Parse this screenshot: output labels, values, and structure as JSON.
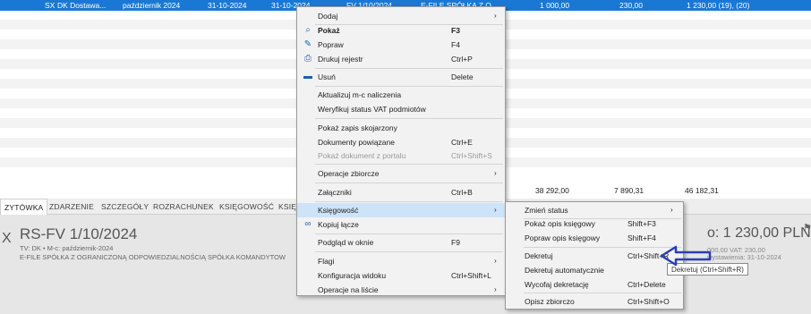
{
  "grid": {
    "selected_row": {
      "col1": "SX",
      "col2": "DK Dostawa...",
      "col3": "październik 2024",
      "col4": "31-10-2024",
      "col5": "31-10-2024",
      "col6": "FV 1/10/2024",
      "col7": "E-FILE SPÓŁKA Z O...",
      "col8": "1 000,00",
      "col9": "230,00",
      "col10": "1 230,00 (19), (20)"
    },
    "totals": {
      "net": "38 292,00",
      "vat": "7 890,31",
      "gross": "46 182,31"
    }
  },
  "tabs": [
    {
      "label": "ZYTÓWKA"
    },
    {
      "label": "ZDARZENIE"
    },
    {
      "label": "SZCZEGÓŁY"
    },
    {
      "label": "ROZRACHUNEK"
    },
    {
      "label": "KSIĘGOWOŚĆ"
    },
    {
      "label": "KSIĘ"
    }
  ],
  "detail": {
    "x_mark": "X",
    "title": "RS-FV 1/10/2024",
    "sub": "TV: DK  •  M-c: październik-2024",
    "company": "E-FILE SPÓŁKA Z OGRANICZONĄ ODPOWIEDZIALNOŚCIĄ SPÓŁKA KOMANDYTOW",
    "right_amount": "o: 1 230,00 PLN",
    "right_small1": "000,00 VAT: 230,00",
    "right_small2": "wystawienia: 31-10-2024"
  },
  "main_menu": {
    "items": [
      {
        "label": "Dodaj",
        "shortcut": "",
        "arrow": "›"
      },
      {
        "label": "Pokaż",
        "shortcut": "F3",
        "icon": "search-icon",
        "glyph": "🔍"
      },
      {
        "label": "Popraw",
        "shortcut": "F4",
        "icon": "pencil-icon",
        "glyph": "✎"
      },
      {
        "label": "Drukuj rejestr",
        "shortcut": "Ctrl+P",
        "icon": "printer-icon",
        "glyph": "⎙"
      },
      {
        "label": "Usuń",
        "shortcut": "Delete",
        "icon": "trash-icon",
        "glyph": "🗑"
      },
      {
        "label": "Aktualizuj m-c naliczenia",
        "shortcut": ""
      },
      {
        "label": "Weryfikuj status VAT podmiotów",
        "shortcut": ""
      },
      {
        "label": "Pokaż zapis skojarzony",
        "shortcut": ""
      },
      {
        "label": "Dokumenty powiązane",
        "shortcut": "Ctrl+E"
      },
      {
        "label": "Pokaż dokument z portalu",
        "shortcut": "Ctrl+Shift+S"
      },
      {
        "label": "Operacje zbiorcze",
        "shortcut": "",
        "arrow": "›"
      },
      {
        "label": "Załączniki",
        "shortcut": "Ctrl+B"
      },
      {
        "label": "Księgowość",
        "shortcut": "",
        "arrow": "›"
      },
      {
        "label": "Kopiuj łącze",
        "shortcut": "",
        "icon": "link-icon",
        "glyph": "⛓"
      },
      {
        "label": "Podgląd w oknie",
        "shortcut": "F9"
      },
      {
        "label": "Flagi",
        "shortcut": "",
        "arrow": "›"
      },
      {
        "label": "Konfiguracja widoku",
        "shortcut": "Ctrl+Shift+L"
      },
      {
        "label": "Operacje na liście",
        "shortcut": "",
        "arrow": "›"
      }
    ]
  },
  "sub_menu": {
    "items": [
      {
        "label": "Zmień status",
        "shortcut": "",
        "arrow": "›"
      },
      {
        "label": "Pokaż opis księgowy",
        "shortcut": "Shift+F3"
      },
      {
        "label": "Popraw opis księgowy",
        "shortcut": "Shift+F4"
      },
      {
        "label": "Dekretuj",
        "shortcut": "Ctrl+Shift+R"
      },
      {
        "label": "Dekretuj automatycznie",
        "shortcut": ""
      },
      {
        "label": "Wycofaj dekretację",
        "shortcut": "Ctrl+Delete"
      },
      {
        "label": "Opisz zbiorczo",
        "shortcut": "Ctrl+Shift+O"
      }
    ]
  },
  "tooltip": {
    "text": "Dekretuj (Ctrl+Shift+R)"
  },
  "colors": {
    "selection": "#1a78d4",
    "menu_highlight": "#cde3f7",
    "annotation_arrow": "#2b3fb0"
  }
}
